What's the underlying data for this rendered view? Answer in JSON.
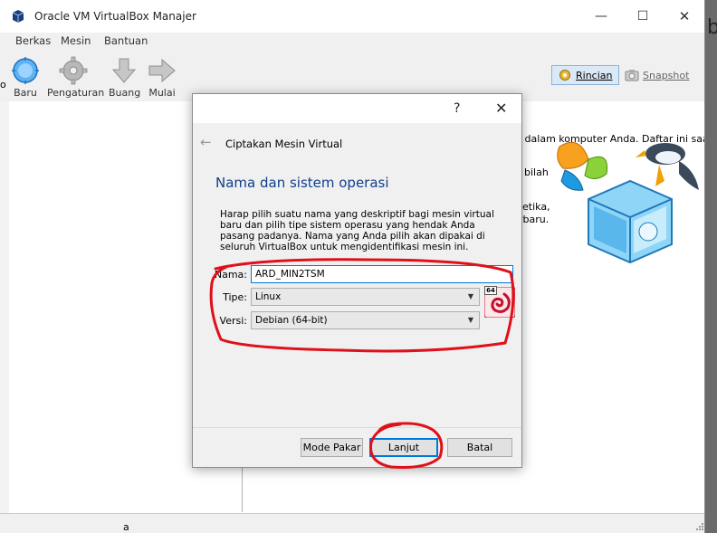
{
  "window": {
    "title": "Oracle VM VirtualBox Manajer",
    "minimize": "—",
    "maximize": "☐",
    "close": "✕"
  },
  "menu": [
    "Berkas",
    "Mesin",
    "Bantuan"
  ],
  "toolbar": {
    "new": "Baru",
    "settings": "Pengaturan",
    "discard": "Buang",
    "start": "Mulai",
    "details": "Rincian",
    "snapshot": "Snapshot"
  },
  "background_text": {
    "line1": "l dalam komputer Anda. Daftar ini saat ini",
    "line2": "bilah",
    "line3": "etika,",
    "line4": "rbaru.",
    "edge_left": "o",
    "bottom_glyph": "a",
    "right_edge_glyph": "b"
  },
  "dialog": {
    "help": "?",
    "close": "✕",
    "back": "←",
    "wizard_title": "Ciptakan Mesin Virtual",
    "heading": "Nama dan sistem operasi",
    "description": "Harap pilih suatu nama yang deskriptif bagi mesin virtual baru dan pilih tipe sistem operasu yang hendak Anda pasang padanya. Nama yang Anda pilih akan dipakai di seluruh VirtualBox untuk mengidentifikasi mesin ini.",
    "name_label": "Nama:",
    "name_value": "ARD_MIN2TSM",
    "type_label": "Tipe:",
    "type_value": "Linux",
    "version_label": "Versi:",
    "version_value": "Debian (64-bit)",
    "os_badge": "64",
    "buttons": {
      "expert": "Mode Pakar",
      "next": "Lanjut",
      "cancel": "Batal"
    }
  },
  "colors": {
    "accent": "#0078d7",
    "heading": "#0f3e8a",
    "annotation": "#e0101a"
  }
}
